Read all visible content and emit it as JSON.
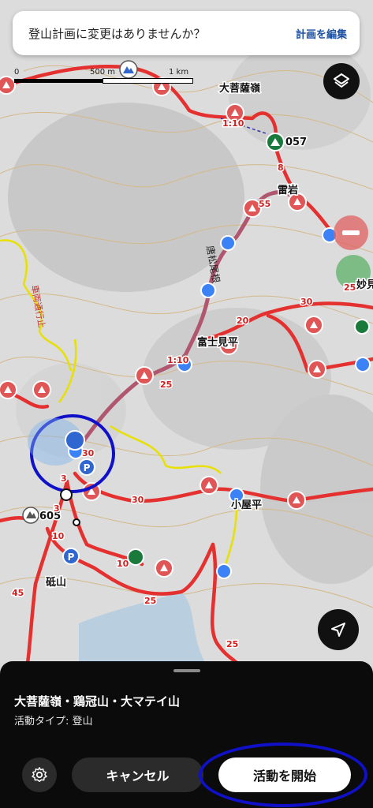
{
  "banner": {
    "message": "登山計画に変更はありませんか？",
    "edit_link": "計画を編集"
  },
  "scale": {
    "start": "0",
    "mid": "500 m",
    "end": "1 km"
  },
  "map": {
    "peaks": [
      {
        "name": "大菩薩嶺"
      },
      {
        "name": "雷岩"
      },
      {
        "name": "富士見平"
      },
      {
        "name": "小屋平"
      },
      {
        "name": "砥山"
      },
      {
        "name": "妙見"
      }
    ],
    "ridge_names": [
      "唐松尾根",
      "車両通行止"
    ],
    "elevations": [
      "057",
      "605"
    ],
    "route_numbers": [
      "1:10",
      "8",
      "55",
      "20",
      "30",
      "25",
      "25",
      "1:10",
      "30",
      "3",
      "3",
      "10",
      "10",
      "25",
      "45",
      "25",
      "30"
    ]
  },
  "sheet": {
    "title": "大菩薩嶺・鶏冠山・大マテイ山",
    "activity_type": "活動タイプ: 登山",
    "cancel_label": "キャンセル",
    "start_label": "活動を開始"
  },
  "colors": {
    "route_red": "#e53030",
    "planned_route": "#b0566e",
    "trail_yellow": "#e8e000",
    "highlight_ring": "#1010c8"
  }
}
